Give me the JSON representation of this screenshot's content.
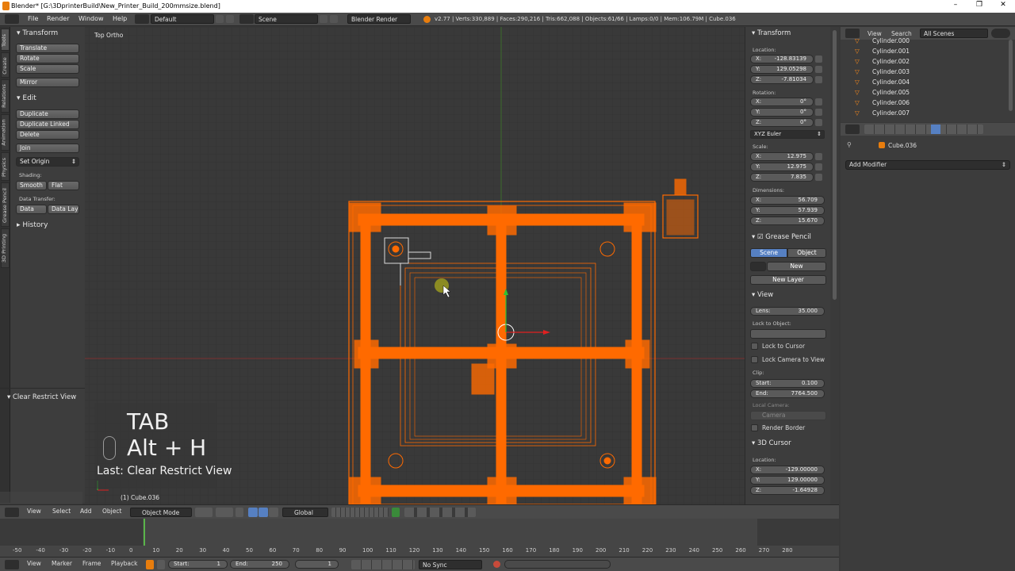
{
  "window": {
    "title": "Blender* [G:\\3DprinterBuild\\New_Printer_Build_200mmsize.blend]",
    "minimize": "–",
    "maximize": "❐",
    "close": "✕"
  },
  "infobar": {
    "menus": [
      "File",
      "Render",
      "Window",
      "Help"
    ],
    "layout": "Default",
    "scene": "Scene",
    "engine": "Blender Render",
    "stats": "v2.77 | Verts:330,889 | Faces:290,216 | Tris:662,088 | Objects:61/66 | Lamps:0/0 | Mem:106.79M | Cube.036"
  },
  "toolshelf": {
    "tabs": [
      "Tools",
      "Create",
      "Relations",
      "Animation",
      "Physics",
      "Grease Pencil",
      "3D Printing"
    ],
    "transform_title": "Transform",
    "transform_buttons": [
      "Translate",
      "Rotate",
      "Scale",
      "Mirror"
    ],
    "edit_title": "Edit",
    "edit_buttons": [
      "Duplicate",
      "Duplicate Linked",
      "Delete",
      "Join"
    ],
    "set_origin": "Set Origin",
    "shading_label": "Shading:",
    "smooth": "Smooth",
    "flat": "Flat",
    "data_transfer_label": "Data Transfer:",
    "data": "Data",
    "data_lay": "Data Lay",
    "history_title": "History",
    "last_op_title": "Clear Restrict View"
  },
  "viewport": {
    "view_label": "Top Ortho",
    "object_label": "(1) Cube.036",
    "overlay_key1": "TAB",
    "overlay_key2": "Alt + H",
    "overlay_last": "Last: Clear Restrict View"
  },
  "nprops": {
    "transform_title": "Transform",
    "location_label": "Location:",
    "loc": [
      {
        "k": "X:",
        "v": "-128.83139"
      },
      {
        "k": "Y:",
        "v": "129.05298"
      },
      {
        "k": "Z:",
        "v": "-7.81034"
      }
    ],
    "rotation_label": "Rotation:",
    "rot": [
      {
        "k": "X:",
        "v": "0°"
      },
      {
        "k": "Y:",
        "v": "0°"
      },
      {
        "k": "Z:",
        "v": "0°"
      }
    ],
    "rotation_mode": "XYZ Euler",
    "scale_label": "Scale:",
    "scale": [
      {
        "k": "X:",
        "v": "12.975"
      },
      {
        "k": "Y:",
        "v": "12.975"
      },
      {
        "k": "Z:",
        "v": "7.835"
      }
    ],
    "dimensions_label": "Dimensions:",
    "dim": [
      {
        "k": "X:",
        "v": "56.709"
      },
      {
        "k": "Y:",
        "v": "57.939"
      },
      {
        "k": "Z:",
        "v": "15.670"
      }
    ],
    "grease_title": "Grease Pencil",
    "gp_scene": "Scene",
    "gp_object": "Object",
    "gp_new": "New",
    "gp_new_layer": "New Layer",
    "view_title": "View",
    "lens_label": "Lens:",
    "lens_value": "35.000",
    "lock_to_object": "Lock to Object:",
    "lock_to_cursor": "Lock to Cursor",
    "lock_camera": "Lock Camera to View",
    "clip_label": "Clip:",
    "clip_start_k": "Start:",
    "clip_start_v": "0.100",
    "clip_end_k": "End:",
    "clip_end_v": "7764.500",
    "local_camera": "Local Camera:",
    "camera": "Camera",
    "render_border": "Render Border",
    "cursor_title": "3D Cursor",
    "cursor_location": "Location:",
    "cursor": [
      {
        "k": "X:",
        "v": "-129.00000"
      },
      {
        "k": "Y:",
        "v": "129.00000"
      },
      {
        "k": "Z:",
        "v": "-1.64928"
      }
    ]
  },
  "outliner": {
    "view": "View",
    "search": "Search",
    "filter": "All Scenes",
    "rows": [
      "Cylinder.000",
      "Cylinder.001",
      "Cylinder.002",
      "Cylinder.003",
      "Cylinder.004",
      "Cylinder.005",
      "Cylinder.006",
      "Cylinder.007"
    ]
  },
  "modifiers": {
    "object_name": "Cube.036",
    "add_modifier": "Add Modifier"
  },
  "view_header": {
    "menus": [
      "View",
      "Select",
      "Add",
      "Object"
    ],
    "mode": "Object Mode",
    "orientation": "Global"
  },
  "timeline": {
    "ticks": [
      "-50",
      "-40",
      "-30",
      "-20",
      "-10",
      "0",
      "10",
      "20",
      "30",
      "40",
      "50",
      "60",
      "70",
      "80",
      "90",
      "100",
      "110",
      "120",
      "130",
      "140",
      "150",
      "160",
      "170",
      "180",
      "190",
      "200",
      "210",
      "220",
      "230",
      "240",
      "250",
      "260",
      "270",
      "280"
    ],
    "menus": [
      "View",
      "Marker",
      "Frame",
      "Playback"
    ],
    "start_label": "Start:",
    "start_value": "1",
    "end_label": "End:",
    "end_value": "250",
    "current": "1",
    "sync": "No Sync"
  },
  "colors": {
    "selected": "#ff6a00",
    "accent_blue": "#5680c2",
    "viewport_bg": "#393939"
  }
}
